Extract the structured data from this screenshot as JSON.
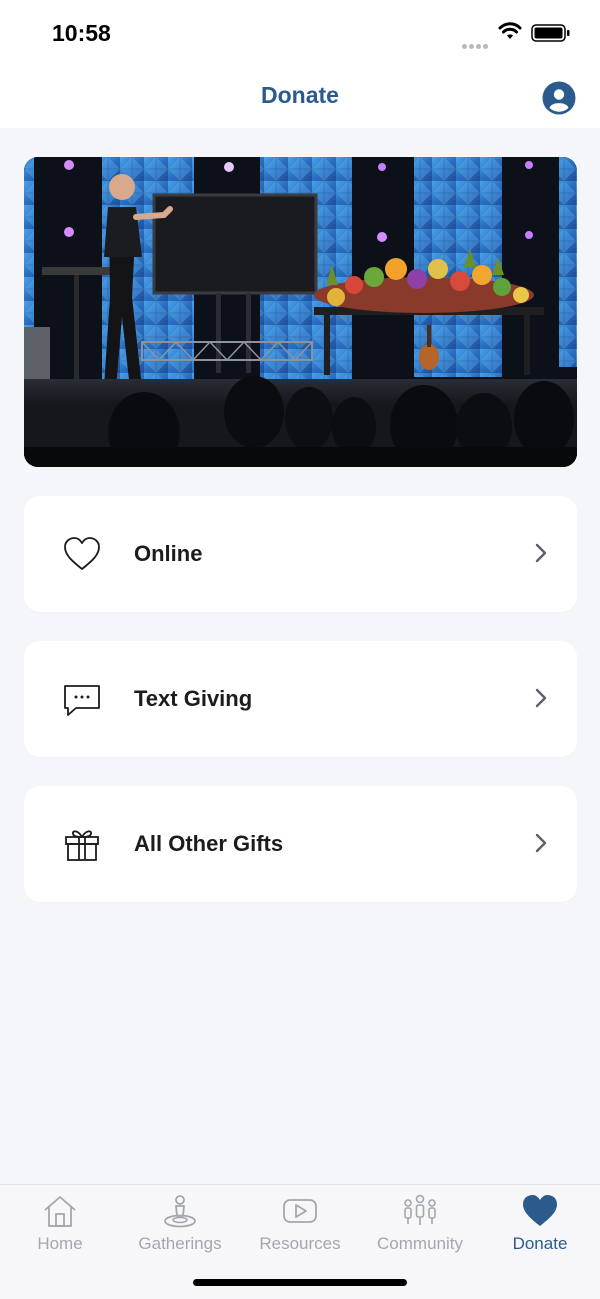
{
  "status_bar": {
    "time": "10:58"
  },
  "header": {
    "title": "Donate"
  },
  "hero": {
    "icon": "stage-photo"
  },
  "options": [
    {
      "label": "Online",
      "icon": "heart-outline-icon"
    },
    {
      "label": "Text Giving",
      "icon": "chat-bubble-icon"
    },
    {
      "label": "All Other Gifts",
      "icon": "gift-icon"
    }
  ],
  "tab_bar": {
    "items": [
      {
        "label": "Home",
        "icon": "home-icon"
      },
      {
        "label": "Gatherings",
        "icon": "person-pin-icon"
      },
      {
        "label": "Resources",
        "icon": "play-icon"
      },
      {
        "label": "Community",
        "icon": "people-icon"
      },
      {
        "label": "Donate",
        "icon": "heart-filled-icon"
      }
    ],
    "active": "Donate"
  },
  "colors": {
    "accent": "#2a5b8c",
    "background": "#f5f6fa",
    "tab_inactive": "#a3a7ad"
  }
}
